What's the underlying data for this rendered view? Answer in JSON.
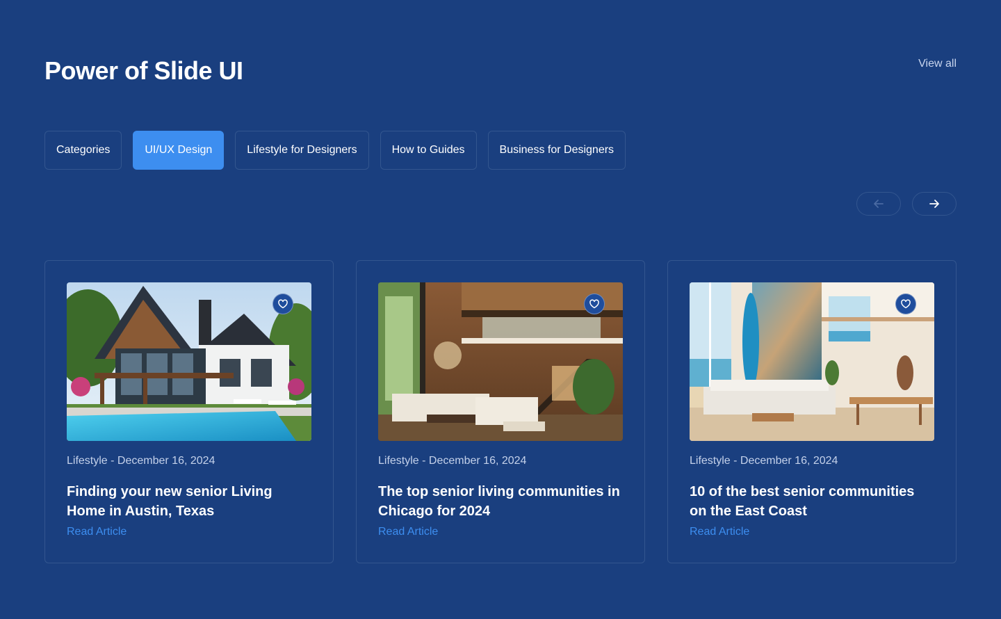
{
  "header": {
    "title": "Power of Slide UI",
    "view_all": "View all"
  },
  "tabs": [
    {
      "label": "Categories",
      "active": false
    },
    {
      "label": "UI/UX Design",
      "active": true
    },
    {
      "label": "Lifestyle for Designers",
      "active": false
    },
    {
      "label": "How to Guides",
      "active": false
    },
    {
      "label": "Business for Designers",
      "active": false
    }
  ],
  "carousel": {
    "prev_icon": "arrow-left-icon",
    "next_icon": "arrow-right-icon"
  },
  "cards": [
    {
      "meta": "Lifestyle - December 16, 2024",
      "title": "Finding your new senior Living Home in Austin, Texas",
      "link": "Read Article",
      "image": "modern-house-with-pool"
    },
    {
      "meta": "Lifestyle - December 16, 2024",
      "title": "The top senior living communities in Chicago for 2024",
      "link": "Read Article",
      "image": "wooden-interior-living-room"
    },
    {
      "meta": "Lifestyle - December 16, 2024",
      "title": "10 of the best senior communities on the East Coast",
      "link": "Read Article",
      "image": "beach-house-interior-with-surfboard"
    }
  ],
  "colors": {
    "background": "#1a3f7f",
    "accent": "#3d8ef0",
    "border": "#33568f"
  }
}
